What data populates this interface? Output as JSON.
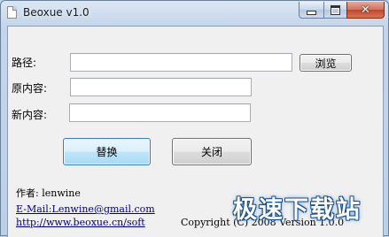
{
  "window": {
    "title": "Beoxue v1.0",
    "minimize_icon": "minimize-icon",
    "maximize_icon": "maximize-icon",
    "close_icon": "close-icon"
  },
  "form": {
    "path_label": "路径:",
    "path_value": "",
    "browse_label": "浏览",
    "old_content_label": "原内容:",
    "old_content_value": "",
    "new_content_label": "新内容:",
    "new_content_value": "",
    "replace_label": "替换",
    "close_label": "关闭"
  },
  "info": {
    "author": "作者: lenwine",
    "email": "E-Mail:Lenwine@gmail.com",
    "website": "http://www.beoxue.cn/soft",
    "copyright": "Copyright (C) 2008 Version 1.0.0"
  },
  "watermark": "极速下载站",
  "colors": {
    "window_frame": "#c3d5ea",
    "client_bg": "#f0f0f0",
    "link": "#00007f",
    "close_button": "#c2452e",
    "default_button_border": "#3c7fb1"
  }
}
